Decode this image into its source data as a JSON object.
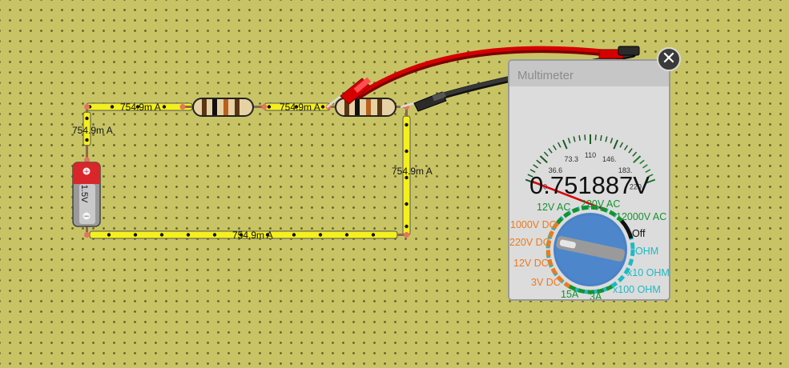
{
  "circuit": {
    "currents": {
      "wire_top_left": "754.9m A",
      "wire_top_mid": "754.9m A",
      "wire_left": "754.9m A",
      "wire_right": "754.9m A",
      "wire_bottom": "754.9m A"
    },
    "battery": {
      "voltage_label": "1.5V",
      "plus_sign": "+",
      "minus_sign": "−"
    }
  },
  "multimeter": {
    "title": "Multimeter",
    "reading": "0.751887V",
    "scale_labels": [
      "0",
      "36.6",
      "73.3",
      "110",
      "146.",
      "183.",
      "220"
    ],
    "needle_value_fraction": 0.0034,
    "modes": {
      "ac12": "12V AC",
      "ac220": "220V AC",
      "ac12000": "12000V AC",
      "off": "Off",
      "dc1000": "1000V DC",
      "dc220": "220V DC",
      "dc12": "12V DC",
      "dc3": "3V DC",
      "a15": "15A",
      "a3": "3A",
      "ohm": "OHM",
      "ohm10": "x10 OHM",
      "ohm100": "x100 OHM"
    },
    "selected_mode": "3V DC",
    "close_glyph": "✕"
  },
  "colors": {
    "wire": "#f4ef1e",
    "probe_red": "#d60000",
    "probe_black": "#222222",
    "dial_blue": "#4a82c6",
    "mode_green": "#16922d",
    "mode_orange": "#ee7a1b",
    "mode_cyan": "#1eb9c4"
  }
}
